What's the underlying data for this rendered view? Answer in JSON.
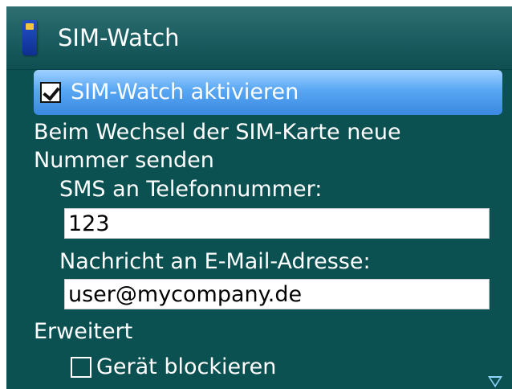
{
  "title_bar": {
    "app_icon": "sim-card-icon",
    "title": "SIM-Watch"
  },
  "options": {
    "activate": {
      "label": "SIM-Watch aktivieren",
      "checked": true
    },
    "send_new_number_label_line1": "Beim Wechsel der SIM-Karte neue",
    "send_new_number_label_line2": "Nummer senden",
    "sms_label": "SMS an Telefonnummer:",
    "sms_value": "123",
    "email_label": "Nachricht an E-Mail-Adresse:",
    "email_value": "user@mycompany.de",
    "advanced_label": "Erweitert",
    "block_device": {
      "label": "Gerät blockieren",
      "checked": false
    }
  },
  "scroll": {
    "icon": "scroll-down-arrow-icon"
  },
  "colors": {
    "background": "#0c5152",
    "focus_highlight": "#58a7f3",
    "text": "#ffffff"
  }
}
